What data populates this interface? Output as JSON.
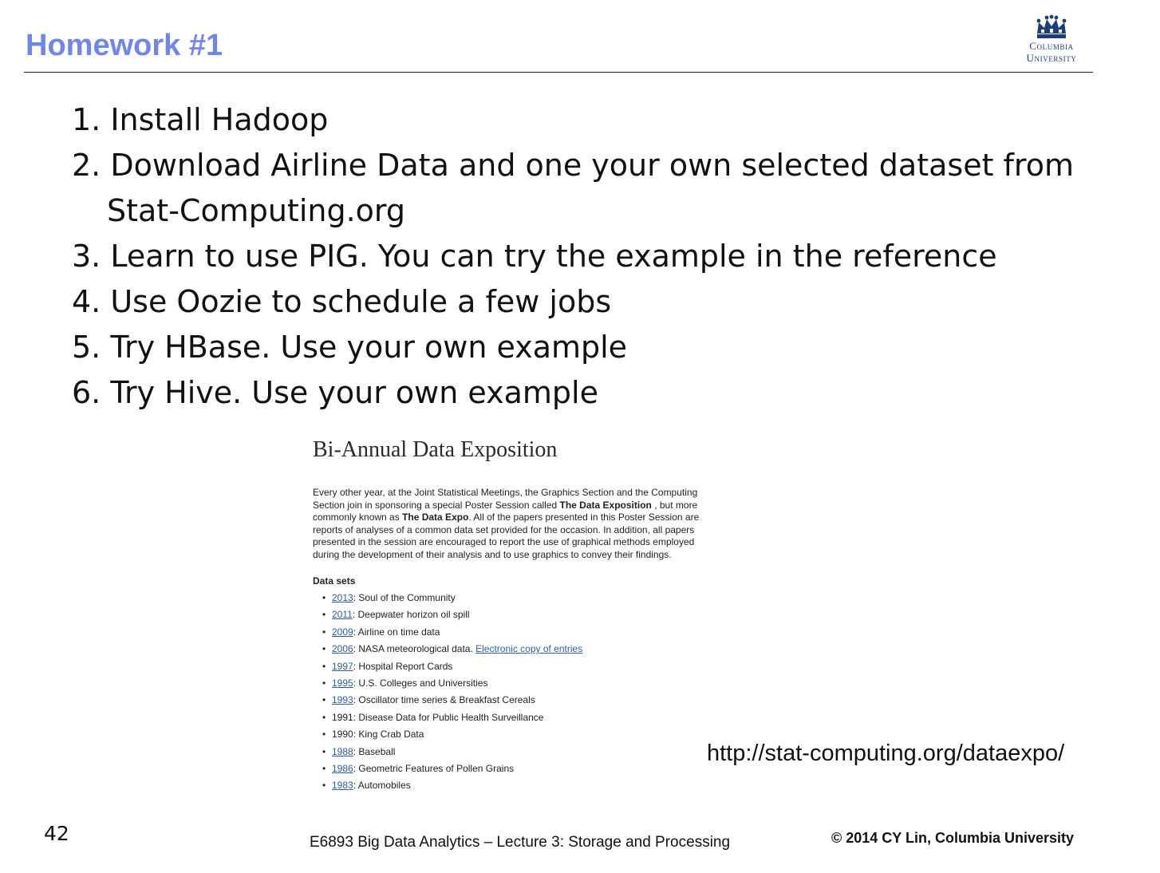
{
  "header": {
    "title": "Homework #1",
    "logo_line1": "Columbia",
    "logo_line2": "University",
    "logo_color": "#1b3f7a",
    "title_color": "#6f86f0"
  },
  "steps": [
    "1. Install Hadoop",
    "2. Download Airline Data and one your own selected dataset from",
    "Stat-Computing.org",
    "3. Learn to use PIG. You can try the example in the reference",
    "4. Use Oozie to schedule a few jobs",
    "5. Try HBase. Use your own example",
    "6. Try Hive. Use your own example"
  ],
  "embed": {
    "title": "Bi-Annual Data Exposition",
    "intro": {
      "t1": "Every other year, at the Joint Statistical Meetings, the Graphics Section and the Computing Section join in sponsoring a special Poster Session called ",
      "b1": "The Data Exposition",
      "t2": " , but more commonly known as ",
      "b2": "The Data Expo",
      "t3": ". All of the papers presented in this Poster Session are reports of analyses of a common data set provided for the occasion. In addition, all papers presented in the session are encouraged to report the use of graphical methods employed during the development of their analysis and to use graphics to convey their findings."
    },
    "datasets_heading": "Data sets",
    "datasets": [
      {
        "year": "2013",
        "link": true,
        "text": ": Soul of the Community",
        "extra": ""
      },
      {
        "year": "2011",
        "link": true,
        "text": ": Deepwater horizon oil spill",
        "extra": ""
      },
      {
        "year": "2009",
        "link": true,
        "text": ": Airline on time data",
        "extra": ""
      },
      {
        "year": "2006",
        "link": true,
        "text": ": NASA meteorological data. ",
        "extra": "Electronic copy of entries"
      },
      {
        "year": "1997",
        "link": true,
        "text": ": Hospital Report Cards",
        "extra": ""
      },
      {
        "year": "1995",
        "link": true,
        "text": ": U.S. Colleges and Universities",
        "extra": ""
      },
      {
        "year": "1993",
        "link": true,
        "text": ": Oscillator time series & Breakfast Cereals",
        "extra": ""
      },
      {
        "year": "1991",
        "link": false,
        "text": ": Disease Data for Public Health Surveillance",
        "extra": ""
      },
      {
        "year": "1990",
        "link": false,
        "text": ": King Crab Data",
        "extra": ""
      },
      {
        "year": "1988",
        "link": true,
        "text": ": Baseball",
        "extra": ""
      },
      {
        "year": "1986",
        "link": true,
        "text": ": Geometric Features of Pollen Grains",
        "extra": ""
      },
      {
        "year": "1983",
        "link": true,
        "text": ": Automobiles",
        "extra": ""
      }
    ],
    "link_color": "#2a5db0"
  },
  "url": "http://stat-computing.org/dataexpo/",
  "footer": {
    "page_number": "42",
    "course": "E6893 Big Data Analytics – Lecture 3: Storage and Processing",
    "copyright": "© 2014 CY Lin, Columbia University"
  }
}
